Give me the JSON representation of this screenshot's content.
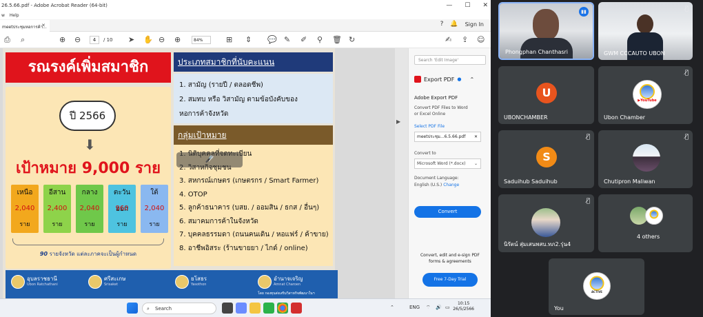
{
  "acrobat": {
    "title": "26.5.66.pdf - Adobe Acrobat Reader (64-bit)",
    "menu": [
      "w",
      "Help"
    ],
    "tab_label": "meetประชุมหอการค้า...",
    "signin": "Sign In",
    "page_current": "4",
    "page_total": "/ 10",
    "zoom": "84%",
    "slide": {
      "banner": "รณรงค์เพิ่มสมาชิก",
      "year": "ปี 2566",
      "target": "เป้าหมาย 9,000 ราย",
      "regions": [
        {
          "name": "เหนือ",
          "value": "2,040",
          "unit": "ราย",
          "color": "#f2a81d"
        },
        {
          "name": "อีสาน",
          "value": "2,400",
          "unit": "ราย",
          "color": "#8ed34a"
        },
        {
          "name": "กลาง",
          "value": "2,040",
          "unit": "ราย",
          "color": "#6fc84a"
        },
        {
          "name": "ตะวันออก",
          "value": "960",
          "unit": "ราย",
          "color": "#4ec3e0"
        },
        {
          "name": "ใต้",
          "value": "2,040",
          "unit": "ราย",
          "color": "#8ab8f0"
        }
      ],
      "footnote": "รายจังหวัด แต่ละภาคจะเป็นผู้กำหนด",
      "footnote_prefix": "90",
      "section1_title": "ประเภทสมาชิกที่นับคะแนน",
      "section1_items": [
        "1.  สามัญ (รายปี / ตลอดชีพ)",
        "2.  สมทบ หรือ วิสามัญ ตามข้อบังคับของ",
        "     หอการค้าจังหวัด"
      ],
      "section2_title": "กลุ่มเป้าหมาย",
      "section2_items": [
        "1.  นิติบุคคลที่จดทะเบียน",
        "2.  วิสาหกิจชุมชน",
        "3.  สหกรณ์เกษตร (เกษตรกร / Smart Farmer)",
        "4.  OTOP",
        "5.  ลูกค้าธนาคาร (บสย. / ออมสิน / ธกส / อื่นๆ)",
        "6.  สมาคมการค้าในจังหวัด",
        "7.  บุคคลธรรมดา (ถนนคนเดิน / หอแฟร์ / ค้าขาย)",
        "8.  อาชีพอิสระ (ร้านขายยา / ไกด์ / online)"
      ],
      "provinces": [
        {
          "th": "อุบลราชธานี",
          "en": "Ubon Ratchathani"
        },
        {
          "th": "ศรีสะเกษ",
          "en": "Srisaket"
        },
        {
          "th": "ยโสธร",
          "en": "Yasothon"
        },
        {
          "th": "อำนาจเจริญ",
          "en": "Amnat Charoen"
        }
      ],
      "province_note": "โดย กองทุนส่งเสริมวิสาหกิจพัฒนาในฯ",
      "muted_overlay": "🎤̸"
    },
    "rightpane": {
      "search_placeholder": "Search 'Edit Image'",
      "export_title": "Export PDF",
      "panel_title": "Adobe Export PDF",
      "panel_desc1": "Convert PDF Files to Word",
      "panel_desc2": "or Excel Online",
      "select_label": "Select PDF File",
      "file_name": "meetประชุม...6.5.66.pdf",
      "convert_to": "Convert to",
      "format": "Microsoft Word (*.docx)",
      "doc_lang": "Document Language:",
      "lang_value": "English (U.S.)",
      "change": "Change",
      "convert_btn": "Convert",
      "promo1": "Convert, edit and e-sign PDF",
      "promo2": "forms & agreements",
      "trial_btn": "Free 7-Day Trial"
    },
    "taskbar": {
      "search": "Search",
      "lang": "ENG",
      "time": "10:15",
      "date": "26/5/2566"
    }
  },
  "meet": {
    "participants": [
      {
        "name": "Phongphan Chanthasri",
        "type": "video"
      },
      {
        "name": "GWM CCCAUTO UBON",
        "type": "video"
      },
      {
        "name": "UBONCHAMBER",
        "type": "letter",
        "letter": "U",
        "color": "#e8541e"
      },
      {
        "name": "Ubon Chamber",
        "type": "logo"
      },
      {
        "name": "Saduihub Saduihub",
        "type": "letter",
        "letter": "S",
        "color": "#f28b16"
      },
      {
        "name": "Chutipron Maliwan",
        "type": "photo"
      },
      {
        "name": "นิรัตน์ สุ่มเสนพสบ.ทภ2.รุ่น4",
        "type": "photo"
      },
      {
        "name": "4 others",
        "type": "group"
      },
      {
        "name": "You",
        "type": "logo"
      }
    ],
    "you_logo_text": "ACTIVE"
  }
}
